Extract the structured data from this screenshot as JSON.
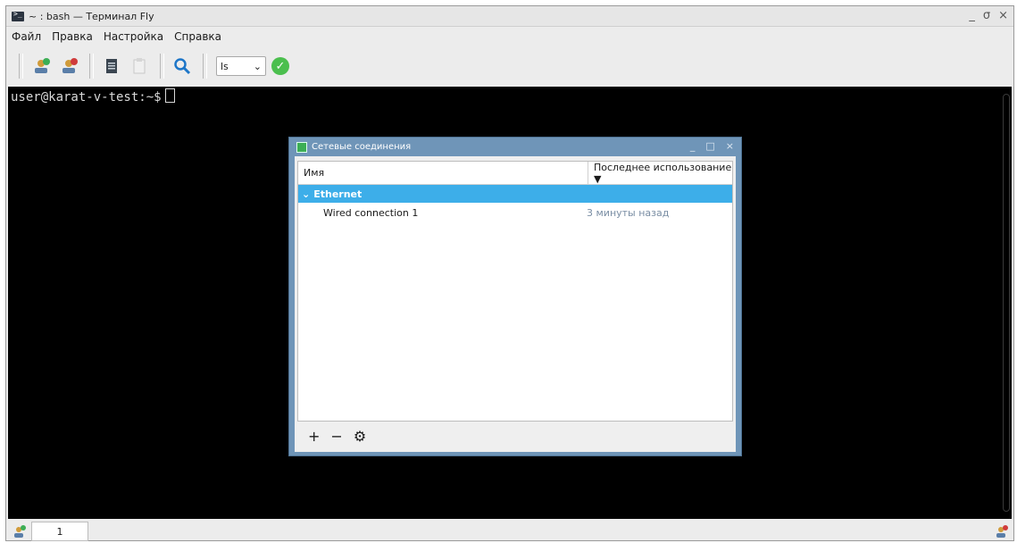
{
  "window": {
    "title": "~ : bash — Терминал Fly",
    "controls": [
      "_",
      "σ",
      "×"
    ]
  },
  "menu": [
    "Файл",
    "Правка",
    "Настройка",
    "Справка"
  ],
  "toolbar": {
    "icons": [
      "new-tab-icon",
      "close-tab-icon",
      "copy-icon",
      "paste-icon",
      "search-icon"
    ],
    "command_combo": {
      "value": "ls"
    }
  },
  "terminal": {
    "prompt": "user@karat-v-test:~$"
  },
  "dialog": {
    "title": "Сетевые соединения",
    "controls": [
      "_",
      "□",
      "×"
    ],
    "columns": {
      "name": "Имя",
      "last_used": "Последнее использование ▼"
    },
    "group": "Ethernet",
    "items": [
      {
        "name": "Wired connection 1",
        "last_used": "3 минуты назад"
      }
    ],
    "footer": {
      "add": "+",
      "remove": "−",
      "settings": "⚙"
    }
  },
  "tabs": [
    "1"
  ],
  "colors": {
    "terminal_bg": "#000000",
    "selection": "#3daee9",
    "dialog_frame": "#6f95b8"
  }
}
